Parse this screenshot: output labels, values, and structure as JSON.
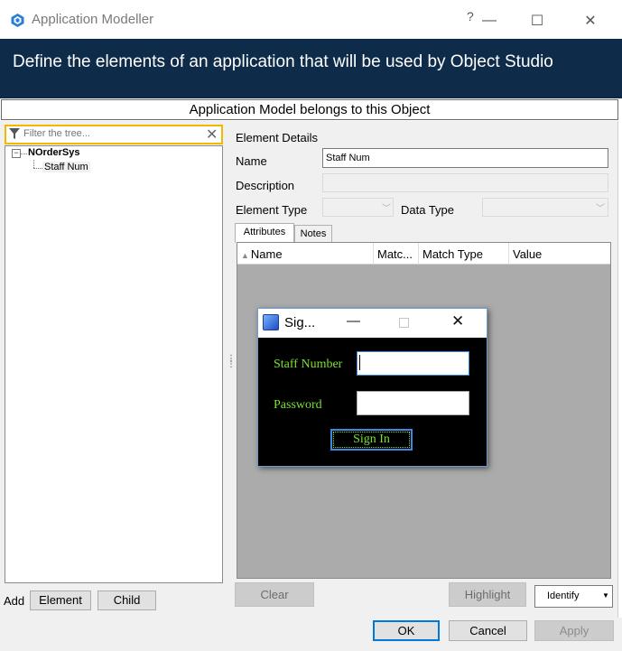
{
  "window": {
    "title": "Application Modeller",
    "help_label": "?",
    "minimize_glyph": "—",
    "maximize_glyph": "☐",
    "close_glyph": "✕"
  },
  "banner": {
    "text": "Define the elements of an application that will be used by Object Studio"
  },
  "object_bar": {
    "text": "Application Model belongs to this Object"
  },
  "tree": {
    "filter_placeholder": "Filter the tree...",
    "toggle_glyph": "−",
    "root": "NOrderSys",
    "child": "Staff Num"
  },
  "left_footer": {
    "add_label": "Add",
    "element_button": "Element",
    "child_button": "Child"
  },
  "details": {
    "heading": "Element Details",
    "name_label": "Name",
    "name_value": "Staff Num",
    "description_label": "Description",
    "element_type_label": "Element Type",
    "data_type_label": "Data Type"
  },
  "tabs": {
    "attributes": "Attributes",
    "notes": "Notes"
  },
  "grid": {
    "columns": [
      "Name",
      "Matc...",
      "Match Type",
      "Value"
    ]
  },
  "actions": {
    "clear": "Clear",
    "highlight": "Highlight",
    "identify": "Identify",
    "ok": "OK",
    "cancel": "Cancel",
    "apply": "Apply"
  },
  "signin_window": {
    "title": "Sig...",
    "staff_label": "Staff Number",
    "password_label": "Password",
    "button": "Sign In",
    "label_color": "#7be02f"
  },
  "colors": {
    "banner": "#0e2b4a",
    "filter_border": "#f3b800",
    "ok_border": "#0078d7"
  }
}
